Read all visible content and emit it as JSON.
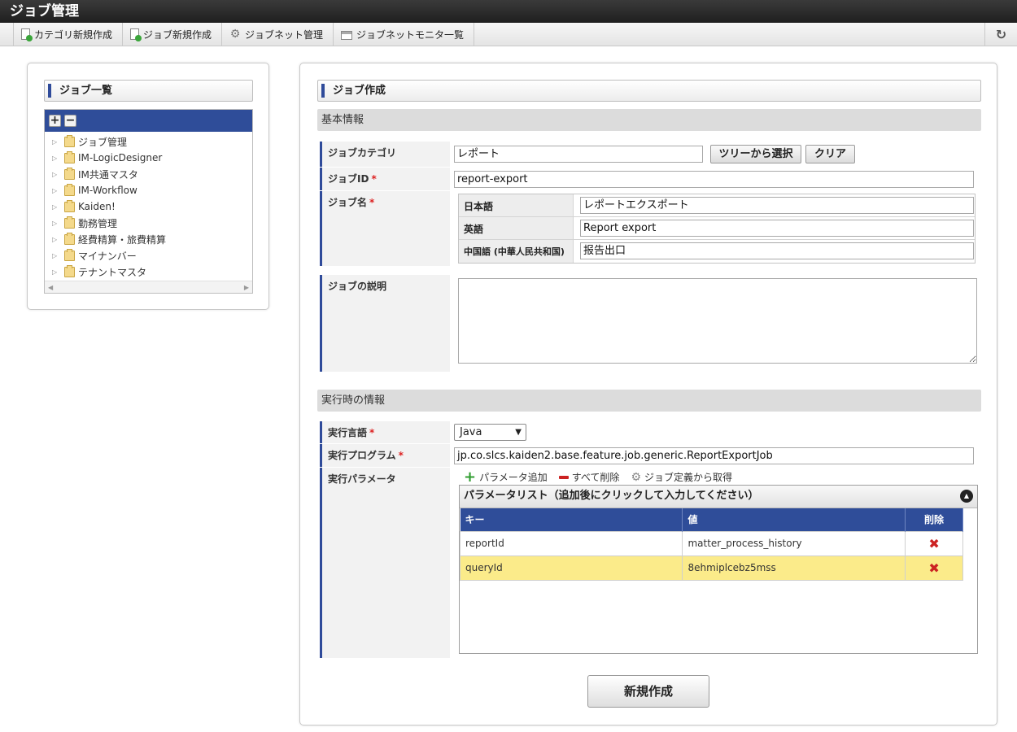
{
  "app": {
    "title": "ジョブ管理"
  },
  "toolbar": {
    "items": [
      {
        "label": "カテゴリ新規作成",
        "icon": "new-category-icon"
      },
      {
        "label": "ジョブ新規作成",
        "icon": "new-job-icon"
      },
      {
        "label": "ジョブネット管理",
        "icon": "gear-icon"
      },
      {
        "label": "ジョブネットモニタ一覧",
        "icon": "monitor-icon"
      }
    ],
    "refresh_icon": "refresh-icon"
  },
  "job_list": {
    "title": "ジョブ一覧",
    "expand_label": "+",
    "collapse_label": "−",
    "nodes": [
      "ジョブ管理",
      "IM-LogicDesigner",
      "IM共通マスタ",
      "IM-Workflow",
      "Kaiden!",
      "勤務管理",
      "経費精算・旅費精算",
      "マイナンバー",
      "テナントマスタ"
    ]
  },
  "job_form": {
    "title": "ジョブ作成",
    "basic_info": {
      "heading": "基本情報",
      "category_label": "ジョブカテゴリ",
      "category_value": "レポート",
      "tree_select_button": "ツリーから選択",
      "clear_button": "クリア",
      "job_id_label": "ジョブID",
      "job_id_value": "report-export",
      "job_name_label": "ジョブ名",
      "names": [
        {
          "lang": "日本語",
          "value": "レポートエクスポート"
        },
        {
          "lang": "英語",
          "value": "Report export"
        },
        {
          "lang": "中国語 (中華人民共和国)",
          "value": "报告出口"
        }
      ],
      "description_label": "ジョブの説明",
      "description_value": ""
    },
    "runtime_info": {
      "heading": "実行時の情報",
      "language_label": "実行言語",
      "language_value": "Java",
      "program_label": "実行プログラム",
      "program_value": "jp.co.slcs.kaiden2.base.feature.job.generic.ReportExportJob",
      "params_label": "実行パラメータ",
      "add_param": "パラメータ追加",
      "delete_all": "すべて削除",
      "from_job_def": "ジョブ定義から取得",
      "param_list_caption": "パラメータリスト（追加後にクリックして入力してください）",
      "columns": [
        "キー",
        "値",
        "削除"
      ],
      "rows": [
        {
          "key": "reportId",
          "value": "matter_process_history"
        },
        {
          "key": "queryId",
          "value": "8ehmiplcebz5mss"
        }
      ]
    },
    "required_mark": "*",
    "submit_button": "新規作成"
  }
}
